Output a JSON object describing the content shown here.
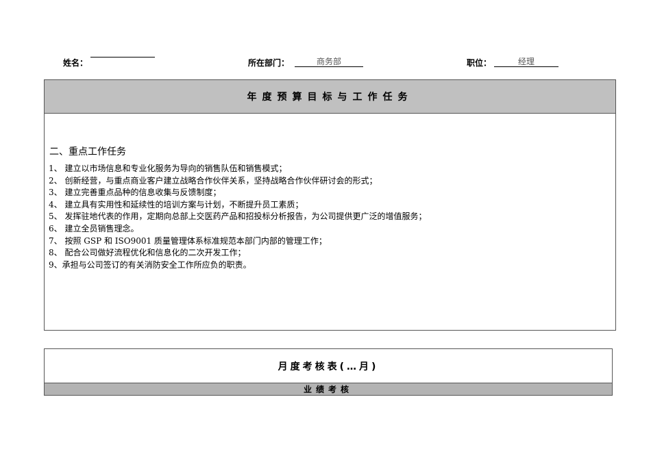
{
  "header": {
    "name_label": "姓名：",
    "name_value": "",
    "dept_label": "所在部门：",
    "dept_value": "商务部",
    "position_label": "职位：",
    "position_value": "经理"
  },
  "annual": {
    "title": "年度预算目标与工作任务",
    "section_heading": "二、重点工作任务",
    "items": [
      "1、 建立以市场信息和专业化服务为导向的销售队伍和销售模式；",
      "2、 创新经营，与重点商业客户建立战略合作伙伴关系，坚持战略合作伙伴研讨会的形式；",
      "3、 建立完善重点品种的信息收集与反馈制度；",
      "4、 建立具有实用性和延续性的培训方案与计划，不断提升员工素质；",
      "5、 发挥驻地代表的作用，定期向总部上交医药产品和招投标分析报告，为公司提供更广泛的增值服务；",
      "6、 建立全员销售理念。",
      "7、 按照 GSP 和 ISO9001 质量管理体系标准规范本部门内部的管理工作；",
      "8、 配合公司做好流程优化和信息化的二次开发工作；",
      "9、承担与公司签订的有关消防安全工作所应负的职责。"
    ]
  },
  "monthly": {
    "title": "月度考核表(…月)",
    "subheader": "业绩考核"
  }
}
